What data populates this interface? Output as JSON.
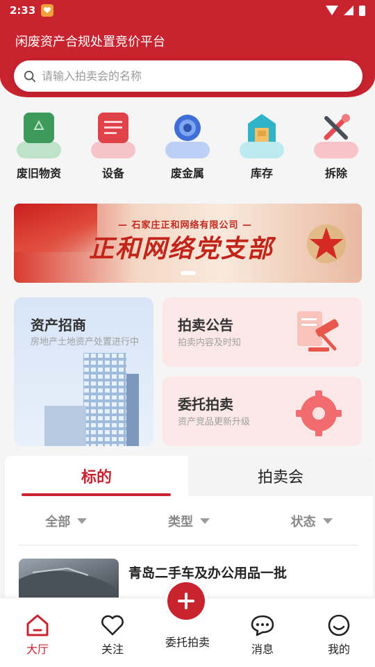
{
  "status_bar": {
    "time": "2:33"
  },
  "header": {
    "platform_title": "闲废资产合规处置竞价平台"
  },
  "search": {
    "placeholder": "请输入拍卖会的名称"
  },
  "categories": [
    {
      "label": "废旧物资",
      "icon": "recycle-box-icon",
      "color": "#3d9a5a"
    },
    {
      "label": "设备",
      "icon": "equipment-icon",
      "color": "#e0424a"
    },
    {
      "label": "废金属",
      "icon": "metal-gear-icon",
      "color": "#3e6fd8"
    },
    {
      "label": "库存",
      "icon": "warehouse-icon",
      "color": "#2fb3c9"
    },
    {
      "label": "拆除",
      "icon": "tools-icon",
      "color": "#e84b55"
    }
  ],
  "banner": {
    "subtitle": "— 石家庄正和网络有限公司 —",
    "title": "正和网络党支部"
  },
  "cards": {
    "assets": {
      "title": "资产招商",
      "subtitle": "房地产土地资产处置进行中"
    },
    "notice": {
      "title": "拍卖公告",
      "subtitle": "拍卖内容及时知"
    },
    "entrust": {
      "title": "委托拍卖",
      "subtitle": "资产竞品更新升级"
    }
  },
  "listing": {
    "tabs": [
      {
        "label": "标的",
        "active": true
      },
      {
        "label": "拍卖会",
        "active": false
      }
    ],
    "filters": [
      {
        "label": "全部"
      },
      {
        "label": "类型"
      },
      {
        "label": "状态"
      }
    ],
    "items": [
      {
        "title": "青岛二手车及办公用品一批"
      }
    ]
  },
  "bottom_nav": {
    "home": "大厅",
    "follow": "关注",
    "entrust": "委托拍卖",
    "messages": "消息",
    "mine": "我的"
  },
  "colors": {
    "primary": "#c8232f",
    "background": "#f5f5f5"
  }
}
